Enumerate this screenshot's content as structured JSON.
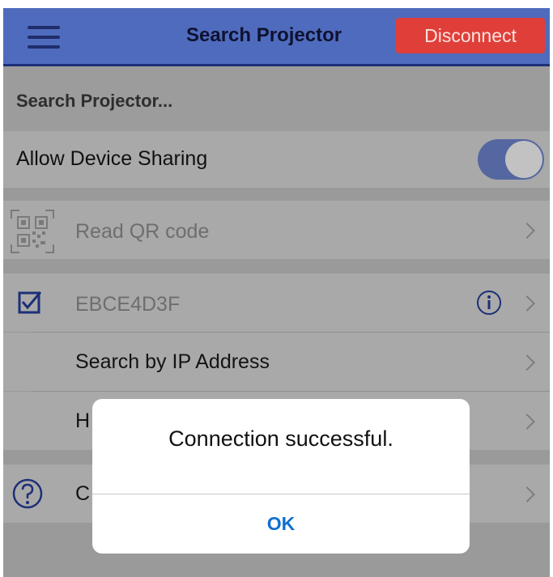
{
  "header": {
    "title": "Search Projector",
    "disconnect_label": "Disconnect",
    "menu_icon": "hamburger-menu-icon",
    "colors": {
      "bar": "#4f6bbd",
      "disconnect": "#e03f39"
    }
  },
  "list": {
    "section_header": "Search Projector...",
    "sharing_label": "Allow Device Sharing",
    "sharing_enabled": true,
    "qr": {
      "label": "Read QR code",
      "icon": "qr-code-icon"
    },
    "projector": {
      "label": "EBCE4D3F",
      "selected": true,
      "check_icon": "checkbox-checked-icon",
      "info_icon": "info-icon"
    },
    "ip_search_label": "Search by IP Address",
    "partial_row_label": "H",
    "help_row": {
      "label": "C",
      "icon": "help-circle-icon"
    }
  },
  "dialog": {
    "message": "Connection successful.",
    "ok_label": "OK"
  }
}
